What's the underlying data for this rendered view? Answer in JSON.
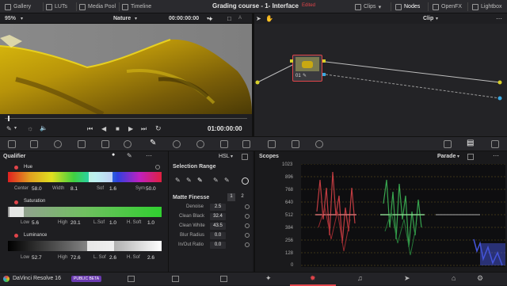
{
  "topbar": {
    "items_left": [
      {
        "label": "Gallery",
        "icon": "gallery-icon"
      },
      {
        "label": "LUTs",
        "icon": "luts-icon"
      },
      {
        "label": "Media Pool",
        "icon": "media-pool-icon"
      },
      {
        "label": "Timeline",
        "icon": "timeline-icon"
      }
    ],
    "project_title": "Grading course - 1- Interface",
    "edited_label": "Edited",
    "items_right": [
      {
        "label": "Clips",
        "icon": "clips-icon"
      },
      {
        "label": "Nodes",
        "icon": "nodes-icon"
      },
      {
        "label": "OpenFX",
        "icon": "openfx-icon"
      },
      {
        "label": "Lightbox",
        "icon": "lightbox-icon"
      }
    ]
  },
  "viewer": {
    "zoom": "95%",
    "clip_name": "Nature",
    "timecode_top": "00:00:00:00",
    "aspect_label": "A",
    "timecode": "01:00:00:00"
  },
  "nodes": {
    "mode": "Clip",
    "node_label": "01"
  },
  "qualifier": {
    "title": "Qualifier",
    "hue": {
      "label": "Hue",
      "center_label": "Center",
      "center": "58.0",
      "width_label": "Width",
      "width": "8.1",
      "soft_label": "Sof",
      "soft": "1.6",
      "sym_label": "Sym",
      "sym": "50.0"
    },
    "saturation": {
      "label": "Saturation",
      "low_label": "Low",
      "low": "5.6",
      "high_label": "High",
      "high": "20.1",
      "lsoft_label": "L.Sof",
      "lsoft": "1.0",
      "hsoft_label": "H. Soft",
      "hsoft": "1.0"
    },
    "luminance": {
      "label": "Luminance",
      "low_label": "Low",
      "low": "52.7",
      "high_label": "High",
      "high": "72.6",
      "lsoft_label": "L. Sof",
      "lsoft": "2.6",
      "hsoft_label": "H. Sof",
      "hsoft": "2.6"
    }
  },
  "selection_range": {
    "title": "Selection Range",
    "mode": "HSL",
    "matte_finesse": "Matte Finesse",
    "tab1": "1",
    "tab2": "2",
    "rows": [
      {
        "label": "Denoise",
        "value": "2.5"
      },
      {
        "label": "Clean Black",
        "value": "32.4"
      },
      {
        "label": "Clean White",
        "value": "43.5"
      },
      {
        "label": "Blur Radius",
        "value": "0.0"
      },
      {
        "label": "In/Out Ratio",
        "value": "0.0"
      }
    ]
  },
  "scopes": {
    "title": "Scopes",
    "mode": "Parade",
    "ticks": [
      "1023",
      "896",
      "768",
      "640",
      "512",
      "384",
      "256",
      "128",
      "0"
    ],
    "colors": {
      "red": "#e0444a",
      "green": "#3fbf5a",
      "blue": "#4a5cf0"
    }
  },
  "bottombar": {
    "app_name": "DaVinci Resolve 16",
    "badge": "PUBLIC BETA"
  },
  "colors": {
    "accent": "#e0444a",
    "bg": "#1c1c1f"
  }
}
